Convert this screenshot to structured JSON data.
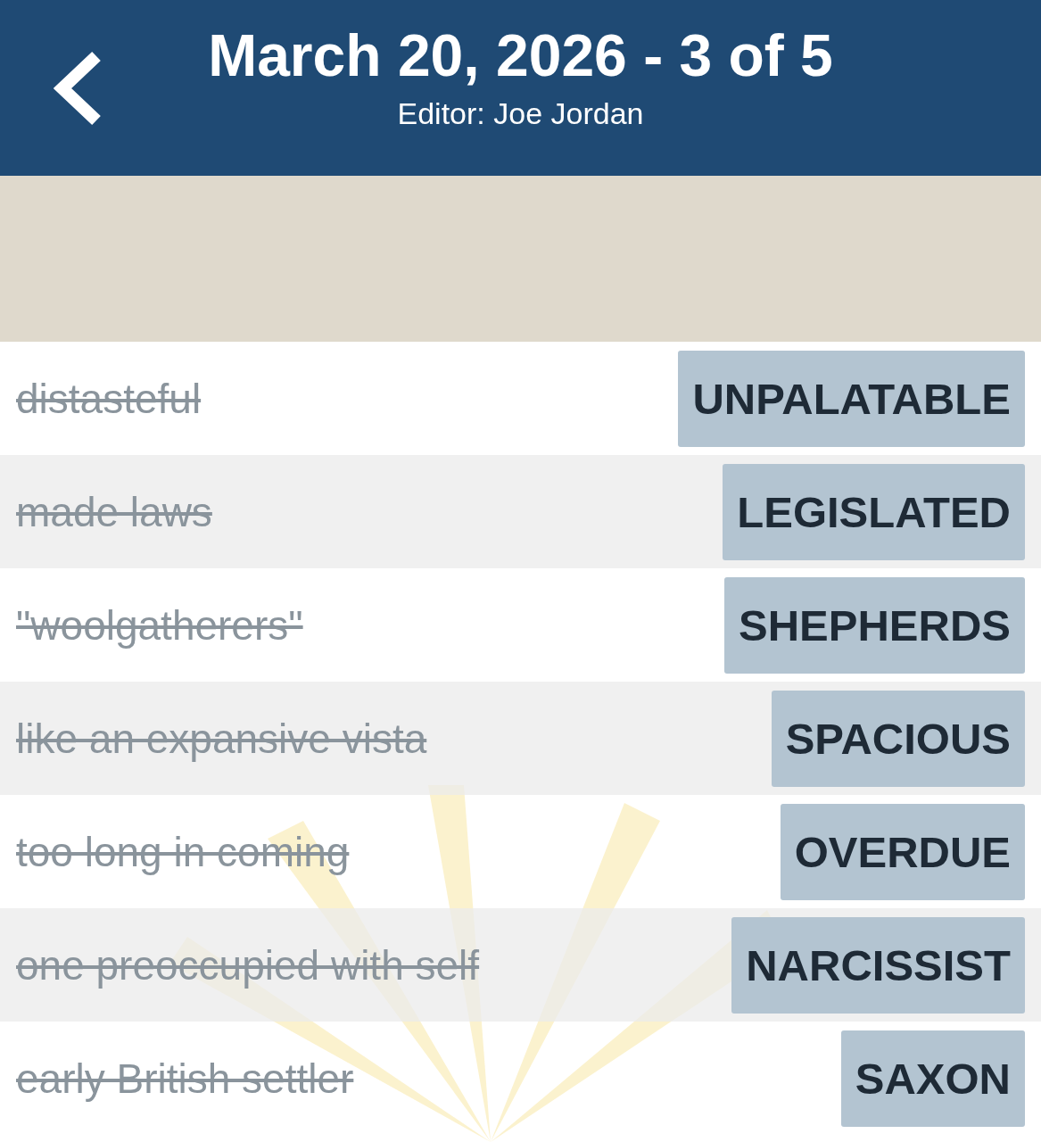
{
  "header": {
    "title": "March 20, 2026 - 3 of 5",
    "subtitle": "Editor: Joe Jordan"
  },
  "clues": [
    {
      "clue": "distasteful",
      "answer": "UNPALATABLE",
      "solved": true
    },
    {
      "clue": "made laws",
      "answer": "LEGISLATED",
      "solved": true
    },
    {
      "clue": "\"woolgatherers\"",
      "answer": "SHEPHERDS",
      "solved": true
    },
    {
      "clue": "like an expansive vista",
      "answer": "SPACIOUS",
      "solved": true
    },
    {
      "clue": "too long in coming",
      "answer": "OVERDUE",
      "solved": true
    },
    {
      "clue": "one preoccupied with self",
      "answer": "NARCISSIST",
      "solved": true
    },
    {
      "clue": "early British settler",
      "answer": "SAXON",
      "solved": true
    }
  ]
}
